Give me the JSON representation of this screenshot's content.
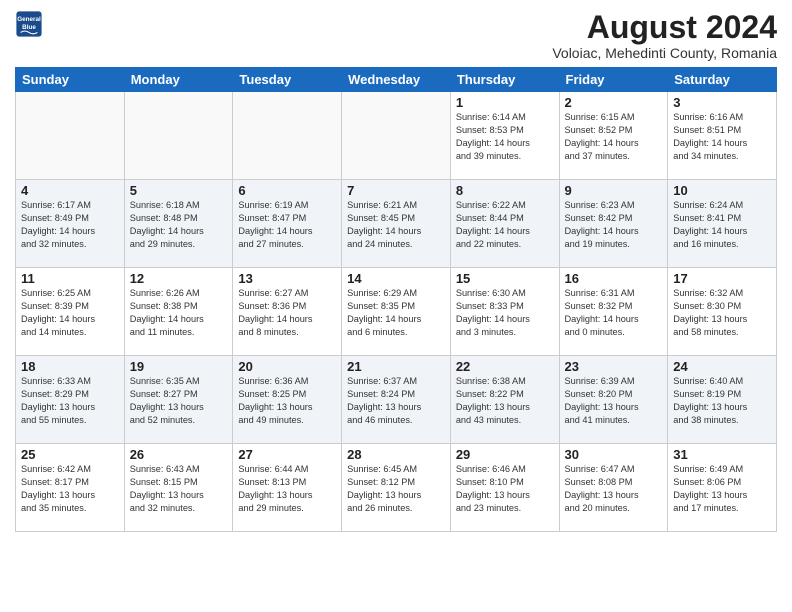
{
  "header": {
    "logo_line1": "General",
    "logo_line2": "Blue",
    "month_year": "August 2024",
    "location": "Voloiac, Mehedinti County, Romania"
  },
  "days_of_week": [
    "Sunday",
    "Monday",
    "Tuesday",
    "Wednesday",
    "Thursday",
    "Friday",
    "Saturday"
  ],
  "weeks": [
    [
      {
        "day": "",
        "detail": ""
      },
      {
        "day": "",
        "detail": ""
      },
      {
        "day": "",
        "detail": ""
      },
      {
        "day": "",
        "detail": ""
      },
      {
        "day": "1",
        "detail": "Sunrise: 6:14 AM\nSunset: 8:53 PM\nDaylight: 14 hours\nand 39 minutes."
      },
      {
        "day": "2",
        "detail": "Sunrise: 6:15 AM\nSunset: 8:52 PM\nDaylight: 14 hours\nand 37 minutes."
      },
      {
        "day": "3",
        "detail": "Sunrise: 6:16 AM\nSunset: 8:51 PM\nDaylight: 14 hours\nand 34 minutes."
      }
    ],
    [
      {
        "day": "4",
        "detail": "Sunrise: 6:17 AM\nSunset: 8:49 PM\nDaylight: 14 hours\nand 32 minutes."
      },
      {
        "day": "5",
        "detail": "Sunrise: 6:18 AM\nSunset: 8:48 PM\nDaylight: 14 hours\nand 29 minutes."
      },
      {
        "day": "6",
        "detail": "Sunrise: 6:19 AM\nSunset: 8:47 PM\nDaylight: 14 hours\nand 27 minutes."
      },
      {
        "day": "7",
        "detail": "Sunrise: 6:21 AM\nSunset: 8:45 PM\nDaylight: 14 hours\nand 24 minutes."
      },
      {
        "day": "8",
        "detail": "Sunrise: 6:22 AM\nSunset: 8:44 PM\nDaylight: 14 hours\nand 22 minutes."
      },
      {
        "day": "9",
        "detail": "Sunrise: 6:23 AM\nSunset: 8:42 PM\nDaylight: 14 hours\nand 19 minutes."
      },
      {
        "day": "10",
        "detail": "Sunrise: 6:24 AM\nSunset: 8:41 PM\nDaylight: 14 hours\nand 16 minutes."
      }
    ],
    [
      {
        "day": "11",
        "detail": "Sunrise: 6:25 AM\nSunset: 8:39 PM\nDaylight: 14 hours\nand 14 minutes."
      },
      {
        "day": "12",
        "detail": "Sunrise: 6:26 AM\nSunset: 8:38 PM\nDaylight: 14 hours\nand 11 minutes."
      },
      {
        "day": "13",
        "detail": "Sunrise: 6:27 AM\nSunset: 8:36 PM\nDaylight: 14 hours\nand 8 minutes."
      },
      {
        "day": "14",
        "detail": "Sunrise: 6:29 AM\nSunset: 8:35 PM\nDaylight: 14 hours\nand 6 minutes."
      },
      {
        "day": "15",
        "detail": "Sunrise: 6:30 AM\nSunset: 8:33 PM\nDaylight: 14 hours\nand 3 minutes."
      },
      {
        "day": "16",
        "detail": "Sunrise: 6:31 AM\nSunset: 8:32 PM\nDaylight: 14 hours\nand 0 minutes."
      },
      {
        "day": "17",
        "detail": "Sunrise: 6:32 AM\nSunset: 8:30 PM\nDaylight: 13 hours\nand 58 minutes."
      }
    ],
    [
      {
        "day": "18",
        "detail": "Sunrise: 6:33 AM\nSunset: 8:29 PM\nDaylight: 13 hours\nand 55 minutes."
      },
      {
        "day": "19",
        "detail": "Sunrise: 6:35 AM\nSunset: 8:27 PM\nDaylight: 13 hours\nand 52 minutes."
      },
      {
        "day": "20",
        "detail": "Sunrise: 6:36 AM\nSunset: 8:25 PM\nDaylight: 13 hours\nand 49 minutes."
      },
      {
        "day": "21",
        "detail": "Sunrise: 6:37 AM\nSunset: 8:24 PM\nDaylight: 13 hours\nand 46 minutes."
      },
      {
        "day": "22",
        "detail": "Sunrise: 6:38 AM\nSunset: 8:22 PM\nDaylight: 13 hours\nand 43 minutes."
      },
      {
        "day": "23",
        "detail": "Sunrise: 6:39 AM\nSunset: 8:20 PM\nDaylight: 13 hours\nand 41 minutes."
      },
      {
        "day": "24",
        "detail": "Sunrise: 6:40 AM\nSunset: 8:19 PM\nDaylight: 13 hours\nand 38 minutes."
      }
    ],
    [
      {
        "day": "25",
        "detail": "Sunrise: 6:42 AM\nSunset: 8:17 PM\nDaylight: 13 hours\nand 35 minutes."
      },
      {
        "day": "26",
        "detail": "Sunrise: 6:43 AM\nSunset: 8:15 PM\nDaylight: 13 hours\nand 32 minutes."
      },
      {
        "day": "27",
        "detail": "Sunrise: 6:44 AM\nSunset: 8:13 PM\nDaylight: 13 hours\nand 29 minutes."
      },
      {
        "day": "28",
        "detail": "Sunrise: 6:45 AM\nSunset: 8:12 PM\nDaylight: 13 hours\nand 26 minutes."
      },
      {
        "day": "29",
        "detail": "Sunrise: 6:46 AM\nSunset: 8:10 PM\nDaylight: 13 hours\nand 23 minutes."
      },
      {
        "day": "30",
        "detail": "Sunrise: 6:47 AM\nSunset: 8:08 PM\nDaylight: 13 hours\nand 20 minutes."
      },
      {
        "day": "31",
        "detail": "Sunrise: 6:49 AM\nSunset: 8:06 PM\nDaylight: 13 hours\nand 17 minutes."
      }
    ]
  ]
}
